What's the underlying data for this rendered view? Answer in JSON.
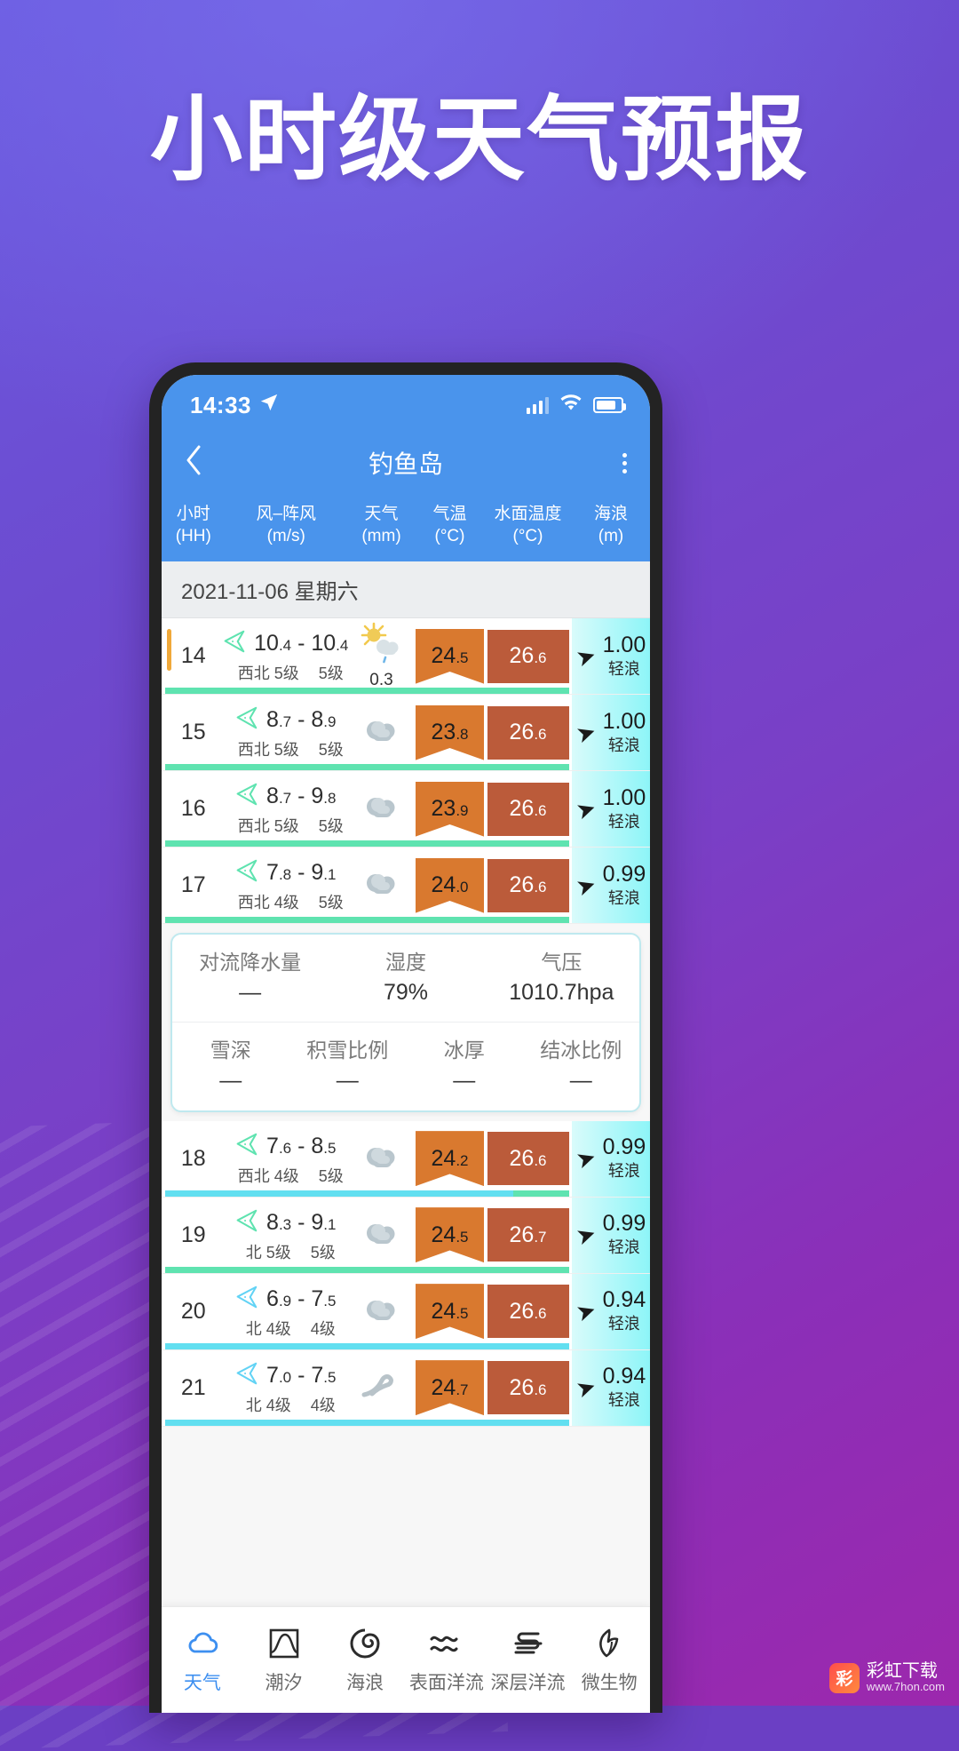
{
  "promo": {
    "headline": "小时级天气预报"
  },
  "statusbar": {
    "time": "14:33",
    "location_icon": "location-arrow-icon",
    "signal_icon": "cellular-signal-icon",
    "wifi_icon": "wifi-icon",
    "battery_icon": "battery-icon"
  },
  "appbar": {
    "back_icon": "back-chevron-icon",
    "title": "钓鱼岛",
    "more_icon": "more-vertical-icon"
  },
  "columns": [
    {
      "name": "小时",
      "unit": "(HH)"
    },
    {
      "name": "风–阵风",
      "unit": "(m/s)"
    },
    {
      "name": "天气",
      "unit": "(mm)"
    },
    {
      "name": "气温",
      "unit": "(°C)"
    },
    {
      "name": "水面温度",
      "unit": "(°C)"
    },
    {
      "name": "海浪",
      "unit": "(m)"
    }
  ],
  "date_band": "2021-11-06  星期六",
  "rows": [
    {
      "hour": "14",
      "mark_color": "#f0a93a",
      "wind_min": "10",
      "wind_min_dec": ".4",
      "wind_max": "10",
      "wind_max_dec": ".4",
      "wind_dir": "西北",
      "wind_level": "5级",
      "gust_level": "5级",
      "arrow_color": "#5fe3b0",
      "weather_icon": "sun-cloud-rain-icon",
      "precip": "0.3",
      "air_temp": "24",
      "air_temp_dec": ".5",
      "air_color": "#d9792f",
      "water_temp": "26",
      "water_temp_dec": ".6",
      "water_color": "#bb5b3a",
      "wave_value": "1.00",
      "wave_label": "轻浪",
      "bar": [
        {
          "color": "#5fe3b0",
          "pct": 100
        }
      ]
    },
    {
      "hour": "15",
      "mark_color": "",
      "wind_min": "8",
      "wind_min_dec": ".7",
      "wind_max": "8",
      "wind_max_dec": ".9",
      "wind_dir": "西北",
      "wind_level": "5级",
      "gust_level": "5级",
      "arrow_color": "#5fe3b0",
      "weather_icon": "cloud-icon",
      "precip": "",
      "air_temp": "23",
      "air_temp_dec": ".8",
      "air_color": "#d9792f",
      "water_temp": "26",
      "water_temp_dec": ".6",
      "water_color": "#bb5b3a",
      "wave_value": "1.00",
      "wave_label": "轻浪",
      "bar": [
        {
          "color": "#5fe3b0",
          "pct": 100
        }
      ]
    },
    {
      "hour": "16",
      "mark_color": "",
      "wind_min": "8",
      "wind_min_dec": ".7",
      "wind_max": "9",
      "wind_max_dec": ".8",
      "wind_dir": "西北",
      "wind_level": "5级",
      "gust_level": "5级",
      "arrow_color": "#5fe3b0",
      "weather_icon": "cloud-icon",
      "precip": "",
      "air_temp": "23",
      "air_temp_dec": ".9",
      "air_color": "#d9792f",
      "water_temp": "26",
      "water_temp_dec": ".6",
      "water_color": "#bb5b3a",
      "wave_value": "1.00",
      "wave_label": "轻浪",
      "bar": [
        {
          "color": "#5fe3b0",
          "pct": 100
        }
      ]
    },
    {
      "hour": "17",
      "mark_color": "",
      "wind_min": "7",
      "wind_min_dec": ".8",
      "wind_max": "9",
      "wind_max_dec": ".1",
      "wind_dir": "西北",
      "wind_level": "4级",
      "gust_level": "5级",
      "arrow_color": "#5fe3b0",
      "weather_icon": "cloud-icon",
      "precip": "",
      "air_temp": "24",
      "air_temp_dec": ".0",
      "air_color": "#d9792f",
      "water_temp": "26",
      "water_temp_dec": ".6",
      "water_color": "#bb5b3a",
      "wave_value": "0.99",
      "wave_label": "轻浪",
      "bar": [
        {
          "color": "#5fe3b0",
          "pct": 100
        }
      ]
    },
    {
      "hour": "18",
      "mark_color": "",
      "wind_min": "7",
      "wind_min_dec": ".6",
      "wind_max": "8",
      "wind_max_dec": ".5",
      "wind_dir": "西北",
      "wind_level": "4级",
      "gust_level": "5级",
      "arrow_color": "#5fe3b0",
      "weather_icon": "cloud-icon",
      "precip": "",
      "air_temp": "24",
      "air_temp_dec": ".2",
      "air_color": "#d9792f",
      "water_temp": "26",
      "water_temp_dec": ".6",
      "water_color": "#bb5b3a",
      "wave_value": "0.99",
      "wave_label": "轻浪",
      "bar": [
        {
          "color": "#62dff0",
          "pct": 86
        },
        {
          "color": "#5fe3b0",
          "pct": 14
        }
      ]
    },
    {
      "hour": "19",
      "mark_color": "",
      "wind_min": "8",
      "wind_min_dec": ".3",
      "wind_max": "9",
      "wind_max_dec": ".1",
      "wind_dir": "北",
      "wind_level": "5级",
      "gust_level": "5级",
      "arrow_color": "#5fe3b0",
      "weather_icon": "cloud-icon",
      "precip": "",
      "air_temp": "24",
      "air_temp_dec": ".5",
      "air_color": "#d9792f",
      "water_temp": "26",
      "water_temp_dec": ".7",
      "water_color": "#bb5b3a",
      "wave_value": "0.99",
      "wave_label": "轻浪",
      "bar": [
        {
          "color": "#5fe3b0",
          "pct": 93
        },
        {
          "color": "#5fe3b0",
          "pct": 7
        }
      ]
    },
    {
      "hour": "20",
      "mark_color": "",
      "wind_min": "6",
      "wind_min_dec": ".9",
      "wind_max": "7",
      "wind_max_dec": ".5",
      "wind_dir": "北",
      "wind_level": "4级",
      "gust_level": "4级",
      "arrow_color": "#62d3f5",
      "weather_icon": "cloud-icon",
      "precip": "",
      "air_temp": "24",
      "air_temp_dec": ".5",
      "air_color": "#d9792f",
      "water_temp": "26",
      "water_temp_dec": ".6",
      "water_color": "#bb5b3a",
      "wave_value": "0.94",
      "wave_label": "轻浪",
      "bar": [
        {
          "color": "#62dff0",
          "pct": 100
        }
      ]
    },
    {
      "hour": "21",
      "mark_color": "",
      "wind_min": "7",
      "wind_min_dec": ".0",
      "wind_max": "7",
      "wind_max_dec": ".5",
      "wind_dir": "北",
      "wind_level": "4级",
      "gust_level": "4级",
      "arrow_color": "#62d3f5",
      "weather_icon": "wind-icon",
      "precip": "",
      "air_temp": "24",
      "air_temp_dec": ".7",
      "air_color": "#d9792f",
      "water_temp": "26",
      "water_temp_dec": ".6",
      "water_color": "#bb5b3a",
      "wave_value": "0.94",
      "wave_label": "轻浪",
      "bar": [
        {
          "color": "#62dff0",
          "pct": 100
        }
      ]
    }
  ],
  "info_card": {
    "row1": [
      {
        "key": "对流降水量",
        "value": "—"
      },
      {
        "key": "湿度",
        "value": "79%"
      },
      {
        "key": "气压",
        "value": "1010.7hpa"
      }
    ],
    "row2": [
      {
        "key": "雪深",
        "value": "—"
      },
      {
        "key": "积雪比例",
        "value": "—"
      },
      {
        "key": "冰厚",
        "value": "—"
      },
      {
        "key": "结冰比例",
        "value": "—"
      }
    ]
  },
  "bottom_nav": [
    {
      "label": "天气",
      "icon": "cloud-icon",
      "active": true
    },
    {
      "label": "潮汐",
      "icon": "tide-curve-icon",
      "active": false
    },
    {
      "label": "海浪",
      "icon": "wave-spiral-icon",
      "active": false
    },
    {
      "label": "表面洋流",
      "icon": "surface-current-icon",
      "active": false
    },
    {
      "label": "深层洋流",
      "icon": "deep-current-icon",
      "active": false
    },
    {
      "label": "微生物",
      "icon": "microorganism-icon",
      "active": false
    }
  ],
  "watermark": {
    "name": "彩虹下载",
    "sub": "www.7hon.com",
    "logo": "彩"
  }
}
